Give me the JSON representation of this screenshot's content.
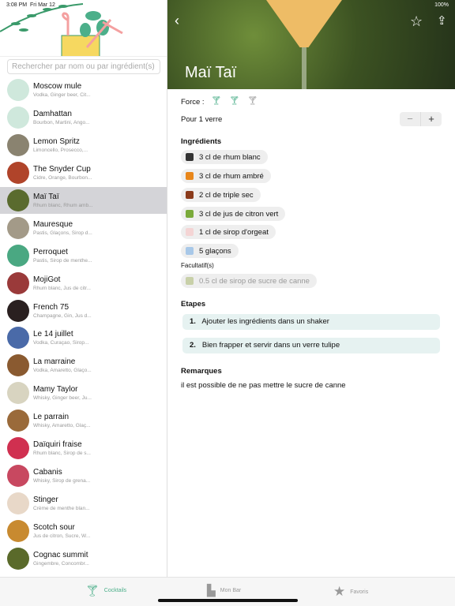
{
  "status": {
    "time": "3:08 PM",
    "date": "Fri Mar 12",
    "battery": "100%"
  },
  "sidebar": {
    "search_placeholder": "Rechercher par nom ou par ingrédient(s)",
    "items": [
      {
        "name": "Moscow mule",
        "sub": "Vodka, Ginger beer, Cit...",
        "avatar_color": "#cfe8dc"
      },
      {
        "name": "Damhattan",
        "sub": "Bourbon, Martini, Ango...",
        "avatar_color": "#cfe8dc"
      },
      {
        "name": "Lemon Spritz",
        "sub": "Limoncello, Prosecco,...",
        "avatar_color": "#8a8370"
      },
      {
        "name": "The Snyder Cup",
        "sub": "Cidre, Orange, Bourbon...",
        "avatar_color": "#b0442a"
      },
      {
        "name": "Maï Taï",
        "sub": "Rhum blanc, Rhum amb...",
        "avatar_color": "#5a6b2e",
        "selected": true
      },
      {
        "name": "Mauresque",
        "sub": "Pastis, Glaçons, Sirop d...",
        "avatar_color": "#a39a88"
      },
      {
        "name": "Perroquet",
        "sub": "Pastis, Sirop de menthe...",
        "avatar_color": "#4aa882"
      },
      {
        "name": "MojiGot",
        "sub": "Rhum blanc, Jus de citr...",
        "avatar_color": "#9a3a3a"
      },
      {
        "name": "French 75",
        "sub": "Champagne, Gin, Jus d...",
        "avatar_color": "#2a2020"
      },
      {
        "name": "Le 14 juillet",
        "sub": "Vodka, Curaçao, Sirop...",
        "avatar_color": "#4a6aa8"
      },
      {
        "name": "La marraine",
        "sub": "Vodka, Amaretto, Glaço...",
        "avatar_color": "#8a5a30"
      },
      {
        "name": "Mamy Taylor",
        "sub": "Whisky, Ginger beer, Ju...",
        "avatar_color": "#d8d4c0"
      },
      {
        "name": "Le parrain",
        "sub": "Whisky, Amaretto, Glaç...",
        "avatar_color": "#9a6a3a"
      },
      {
        "name": "Daïquiri fraise",
        "sub": "Rhum blanc, Sirop de s...",
        "avatar_color": "#d03050"
      },
      {
        "name": "Cabanis",
        "sub": "Whisky, Sirop de grena...",
        "avatar_color": "#c84860"
      },
      {
        "name": "Stinger",
        "sub": "Crème de menthe blan...",
        "avatar_color": "#e8d8c8"
      },
      {
        "name": "Scotch sour",
        "sub": "Jus de citron, Sucre, W...",
        "avatar_color": "#c88a30"
      },
      {
        "name": "Cognac summit",
        "sub": "Gingembre, Concombr...",
        "avatar_color": "#5a6a2a"
      }
    ]
  },
  "detail": {
    "title": "Maï Taï",
    "force_label": "Force :",
    "force_level": 2,
    "force_max": 3,
    "servings_label": "Pour 1 verre",
    "minus": "−",
    "plus": "+",
    "ingredients_title": "Ingrédients",
    "ingredients": [
      {
        "text": "3 cl de rhum blanc",
        "color": "#333"
      },
      {
        "text": "3 cl de rhum ambré",
        "color": "#e8861a"
      },
      {
        "text": "2 cl de triple sec",
        "color": "#8a3a1a"
      },
      {
        "text": "3 cl de jus de citron vert",
        "color": "#7aaa3a"
      },
      {
        "text": "1 cl de sirop d'orgeat",
        "color": "#f4d4d4"
      },
      {
        "text": "5 glaçons",
        "color": "#a8c8e8"
      }
    ],
    "optional_title": "Facultatif(s)",
    "optional": [
      {
        "text": "0.5 cl de sirop de sucre de canne",
        "color": "#c8d0a8"
      }
    ],
    "steps_title": "Etapes",
    "steps": [
      {
        "n": "1.",
        "text": "Ajouter les ingrédients dans un shaker"
      },
      {
        "n": "2.",
        "text": "Bien frapper et servir dans un verre tulipe"
      }
    ],
    "remarks_title": "Remarques",
    "remarks": "il est possible de ne pas mettre le sucre de canne"
  },
  "tabbar": {
    "tabs": [
      {
        "label": "Cocktails",
        "active": true
      },
      {
        "label": "Mon Bar"
      },
      {
        "label": "Favoris"
      }
    ]
  },
  "colors": {
    "accent": "#4caf8a",
    "selected_row": "#d4d4d8",
    "step_bg": "#e6f2f1"
  }
}
